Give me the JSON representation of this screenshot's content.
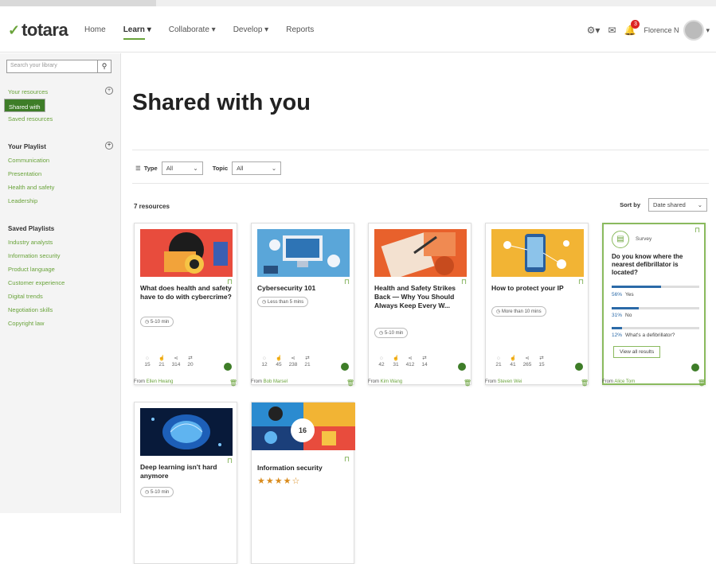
{
  "app": {
    "logo_text": "totara"
  },
  "nav": {
    "items": [
      "Home",
      "Learn",
      "Collaborate",
      "Develop",
      "Reports"
    ],
    "user": "Florence N",
    "notifications": "3"
  },
  "sidebar": {
    "search_placeholder": "Search your library",
    "your_resources": "Your resources",
    "shared_with_you": "Shared with you",
    "saved_resources": "Saved resources",
    "your_playlist_heading": "Your Playlist",
    "playlist_items": [
      "Communication",
      "Presentation",
      "Health and safety",
      "Leadership"
    ],
    "saved_playlists_heading": "Saved Playlists",
    "saved_playlist_items": [
      "Industry analysts",
      "Information security",
      "Product language",
      "Customer experience",
      "Digital trends",
      "Negotiation skills",
      "Copyright law"
    ]
  },
  "main": {
    "title": "Shared with you",
    "filter_type_label": "Type",
    "filter_type_value": "All",
    "filter_topic_label": "Topic",
    "filter_topic_value": "All",
    "count": "7 resources",
    "sort_label": "Sort by",
    "sort_value": "Date shared"
  },
  "cards": [
    {
      "title": "What does health and safety have to do with cybercrime?",
      "time": "5-10 min",
      "stats": [
        "15",
        "21",
        "314",
        "20"
      ],
      "from": "From ",
      "from_name": "Ellen Hwang"
    },
    {
      "title": "Cybersecurity 101",
      "time": "Less than 5 mins",
      "stats": [
        "12",
        "45",
        "238",
        "21"
      ],
      "from": "From ",
      "from_name": "Bob Marsel"
    },
    {
      "title": "Health and Safety Strikes Back — Why You Should Always Keep Every W...",
      "time": "5-10 min",
      "stats": [
        "42",
        "31",
        "412",
        "14"
      ],
      "from": "From ",
      "from_name": "Kim Wang"
    },
    {
      "title": "How to protect your IP",
      "time": "More than 10 mins",
      "stats": [
        "21",
        "41",
        "265",
        "15"
      ],
      "from": "From ",
      "from_name": "Steven Wei"
    },
    {
      "title": "Deep learning isn't hard anymore",
      "time": "5-10 min"
    },
    {
      "title": "Information security",
      "stars": "★★★★☆",
      "badge": "16"
    }
  ],
  "survey": {
    "label": "Survey",
    "question": "Do you know where the nearest defibrillator is located?",
    "options": [
      {
        "pct": "56%",
        "text": "Yes",
        "value": 56
      },
      {
        "pct": "31%",
        "text": "No",
        "value": 31
      },
      {
        "pct": "12%",
        "text": "What's a defibrillator?",
        "value": 12
      }
    ],
    "button": "View all results",
    "from": "From ",
    "from_name": "Alice Tom"
  },
  "colors": {
    "brand": "#69a33a",
    "selected": "#3e7d28",
    "bar": "#2b6aa8"
  }
}
